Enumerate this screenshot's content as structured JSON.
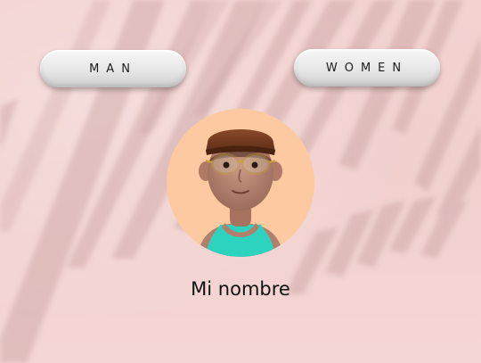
{
  "buttons": {
    "man_label": "MAN",
    "women_label": "WOMEN"
  },
  "profile": {
    "name": "Mi nombre",
    "avatar_icon": "avatar-3d-man-icon"
  },
  "colors": {
    "background": "#f2d1cf",
    "avatar_bg": "#fcc9a0",
    "button": "#e9e9e9",
    "text": "#111111"
  }
}
